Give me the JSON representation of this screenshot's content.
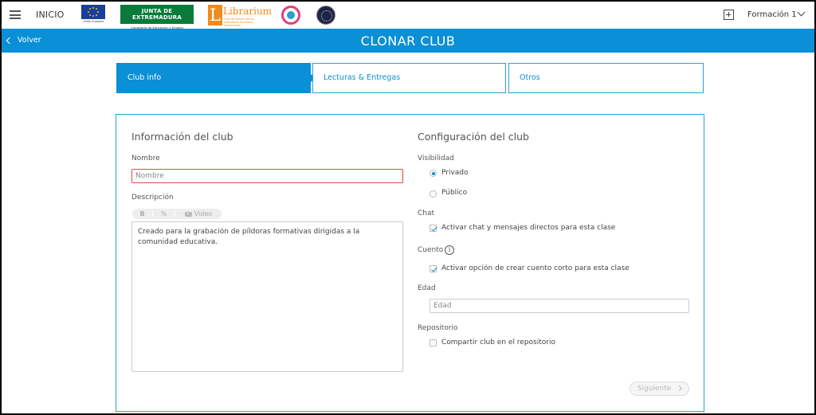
{
  "topbar": {
    "home_label": "INICIO",
    "logos": {
      "eu_caption": "Unión Europea",
      "junta_title": "JUNTA DE EXTREMADURA",
      "junta_sub": "Consejería de Educación y Empleo",
      "librarium_title": "Librarium",
      "librarium_sub": "Club de lectura de las bibliotecas escolares extremeñas"
    },
    "user_label": "Formación 1"
  },
  "header": {
    "back_label": "Volver",
    "title": "CLONAR CLUB"
  },
  "steps": [
    {
      "label": "Club info",
      "active": true
    },
    {
      "label": "Lecturas & Entregas",
      "active": false
    },
    {
      "label": "Otros",
      "active": false
    }
  ],
  "info": {
    "heading": "Información del club",
    "name_label": "Nombre",
    "name_placeholder": "Nombre",
    "desc_label": "Descripción",
    "toolbar": {
      "bold": "B",
      "link": "%",
      "video": "Video"
    },
    "desc_value": "Creado para la grabación de píldoras formativas dirigidas a la comunidad educativa."
  },
  "config": {
    "heading": "Configuración del club",
    "visibility_label": "Visibilidad",
    "visibility_options": [
      "Privado",
      "Público"
    ],
    "visibility_selected": "Privado",
    "chat_label": "Chat",
    "chat_option": "Activar chat y mensajes directos para esta clase",
    "chat_checked": true,
    "cuento_label": "Cuento",
    "cuento_option": "Activar opción de crear cuento corto para esta clase",
    "cuento_checked": true,
    "edad_label": "Edad",
    "edad_placeholder": "Edad",
    "repo_label": "Repositorio",
    "repo_option": "Compartir club en el repositorio",
    "repo_checked": false
  },
  "next_label": "Siguiente",
  "colors": {
    "accent": "#0b8fd6",
    "error_border": "#e04848"
  },
  "icons": [
    "menu-icon",
    "plus-square-icon",
    "chevron-down-icon",
    "chevron-left-icon",
    "info-icon",
    "video-icon",
    "link-icon",
    "chevron-right-icon"
  ]
}
